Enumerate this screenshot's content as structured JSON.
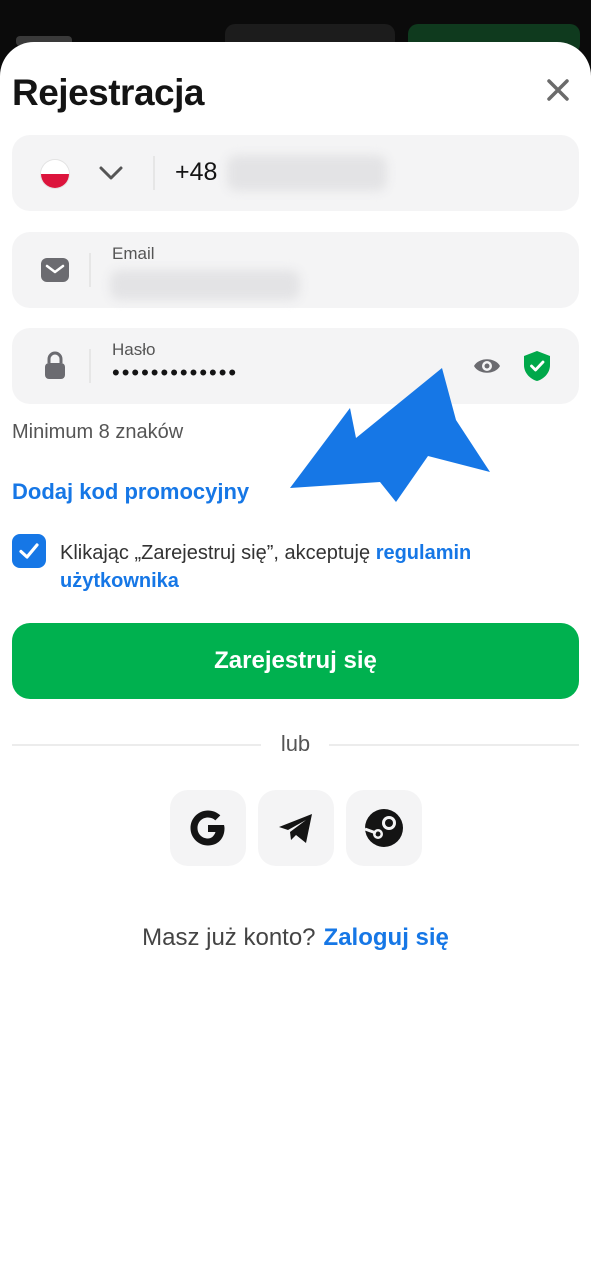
{
  "sheet": {
    "title": "Rejestracja",
    "close_icon": "close-icon"
  },
  "phone": {
    "country_flag": "poland-flag-icon",
    "prefix": "+48"
  },
  "email": {
    "label": "Email"
  },
  "password": {
    "label": "Hasło",
    "masked_value": "•••••••••••••",
    "hint": "Minimum 8 znaków"
  },
  "promo": {
    "label": "Dodaj kod promocyjny"
  },
  "terms": {
    "text": "Klikając „Zarejestruj się”, akceptuję ",
    "link": "regulamin użytkownika",
    "checked": true
  },
  "submit": {
    "label": "Zarejestruj się"
  },
  "divider": {
    "label": "lub"
  },
  "social": [
    "google-icon",
    "telegram-icon",
    "steam-icon"
  ],
  "login": {
    "prompt": "Masz już konto?",
    "link": "Zaloguj się"
  },
  "colors": {
    "accent": "#1677e6",
    "primary_button": "#00b14f",
    "annotation_arrow": "#1677e6"
  }
}
